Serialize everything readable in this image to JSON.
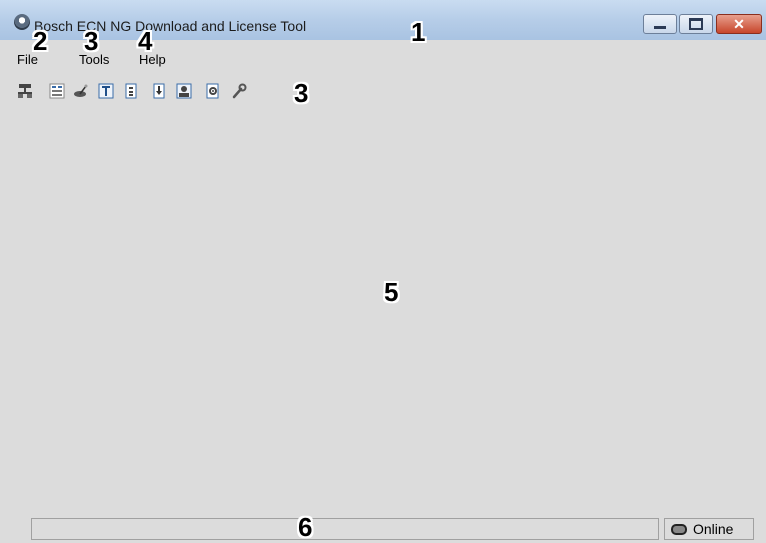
{
  "window": {
    "title": "Bosch ECN NG Download and License Tool",
    "controls": [
      "minimize-icon",
      "maximize-icon",
      "close-icon"
    ]
  },
  "menu": {
    "items": [
      {
        "label": "File"
      },
      {
        "label": "Tools"
      },
      {
        "label": "Help"
      }
    ]
  },
  "toolbar": {
    "icons": [
      "network-icon",
      "data-table-icon",
      "satellite-dish-icon",
      "text-icon",
      "document-icon",
      "download-icon",
      "user-icon",
      "settings-document-icon",
      "wrench-icon"
    ]
  },
  "statusbar": {
    "message": "",
    "connection_status": "Online",
    "connection_icon": "connection-icon"
  },
  "callouts": {
    "c1": "1",
    "c2": "2",
    "c3_menu": "3",
    "c4": "4",
    "c3_toolbar": "3",
    "c5": "5",
    "c6": "6"
  },
  "colors": {
    "titlebar": "#b6cde8",
    "client_area": "#dcdcdc",
    "close_button": "#c7462b"
  }
}
